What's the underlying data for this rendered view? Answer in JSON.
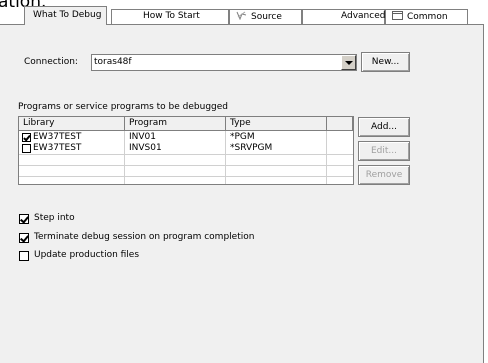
{
  "window": {
    "clipped_title": "ation."
  },
  "tabs": [
    {
      "label": "What To Debug",
      "active": true,
      "icon": "none"
    },
    {
      "label": "How To Start",
      "active": false,
      "icon": "none"
    },
    {
      "label": "Source",
      "active": false,
      "icon": "source-icon"
    },
    {
      "label": "Advanced",
      "active": false,
      "icon": "none"
    },
    {
      "label": "Common",
      "active": false,
      "icon": "common-icon"
    }
  ],
  "connection": {
    "label": "Connection:",
    "value": "toras48f",
    "new_button": "New..."
  },
  "programs": {
    "section_label": "Programs or service programs to be debugged",
    "columns": [
      "Library",
      "Program",
      "Type"
    ],
    "rows": [
      {
        "checked": true,
        "library": "EW37TEST",
        "program": "INV01",
        "type": "*PGM"
      },
      {
        "checked": false,
        "library": "EW37TEST",
        "program": "INVS01",
        "type": "*SRVPGM"
      }
    ],
    "buttons": {
      "add": "Add...",
      "edit": "Edit...",
      "remove": "Remove"
    }
  },
  "options": [
    {
      "label": "Step into",
      "checked": true
    },
    {
      "label": "Terminate debug session on program completion",
      "checked": true
    },
    {
      "label": "Update production files",
      "checked": false
    }
  ],
  "colors": {
    "panel": "#f0f0f0",
    "border": "#808080",
    "disabled_text": "#a0a0a0"
  }
}
